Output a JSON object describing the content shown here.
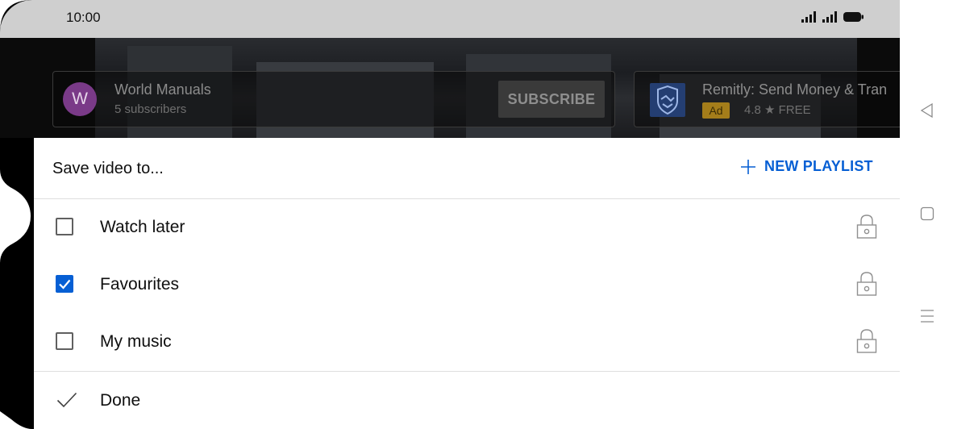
{
  "status_bar": {
    "time": "10:00",
    "icons": [
      "signal-icon",
      "signal-icon",
      "battery-icon"
    ]
  },
  "background_video": {
    "channel_card": {
      "avatar_letter": "W",
      "name": "World Manuals",
      "subscribers": "5 subscribers",
      "subscribe_label": "SUBSCRIBE"
    },
    "ad_card": {
      "title": "Remitly: Send Money & Tran",
      "badge": "Ad",
      "rating": "4.8 ★ FREE"
    }
  },
  "sheet": {
    "title": "Save video to...",
    "new_playlist_label": "NEW PLAYLIST",
    "playlists": [
      {
        "label": "Watch later",
        "checked": false,
        "private": true
      },
      {
        "label": "Favourites",
        "checked": true,
        "private": true
      },
      {
        "label": "My music",
        "checked": false,
        "private": true
      }
    ],
    "done_label": "Done"
  },
  "colors": {
    "accent": "#065fd4",
    "status_bar": "#cfcfcf",
    "background_dark": "#0b0b0b"
  },
  "nav_bar": {
    "icons": [
      "back-icon",
      "home-icon",
      "recents-icon"
    ]
  }
}
